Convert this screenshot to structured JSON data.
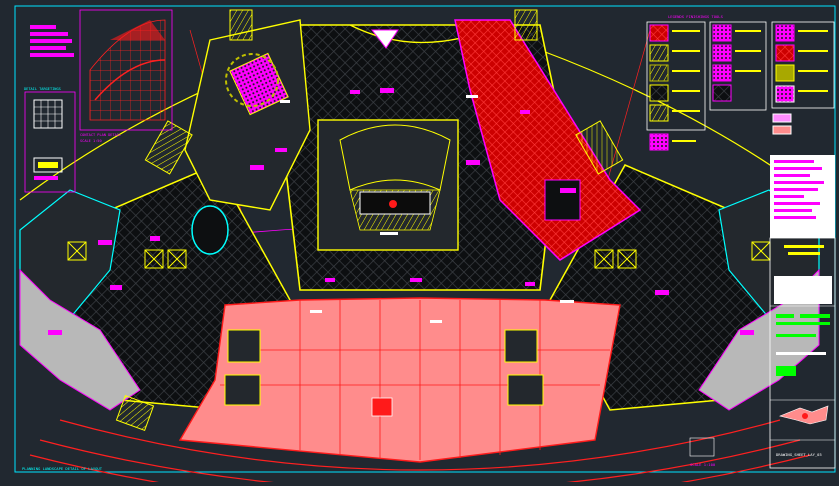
{
  "drawing": {
    "background_color": "#212830",
    "sheet_border_color": "#00e5ff",
    "palette": {
      "red": "#ff1a1a",
      "yellow": "#ffff00",
      "magenta": "#ff00ff",
      "cyan": "#00ffff",
      "salmon": "#ff8c8c",
      "white": "#ffffff",
      "green": "#00ff00",
      "grey": "#b8b8b8",
      "dark_hatch": "#0b0b0b"
    }
  },
  "labels": {
    "detail_left": "DETAIL TARGETINGS",
    "detail_upper": "CONTACT PLAN DETAIL",
    "detail_upper_2": "SCALE 1:50",
    "legend_title": "LEGENDS FINISHINGS TOOLS",
    "footer_left": "PLANNING LANDSCAPE DETAIL OF LAYOUT",
    "footer_right": "SCALE 1:100",
    "sheet_number": "DRAWING_SHEET_LAY_03"
  },
  "icons": {
    "compass": "north-arrow-icon",
    "key_plan": "key-plan-icon"
  }
}
